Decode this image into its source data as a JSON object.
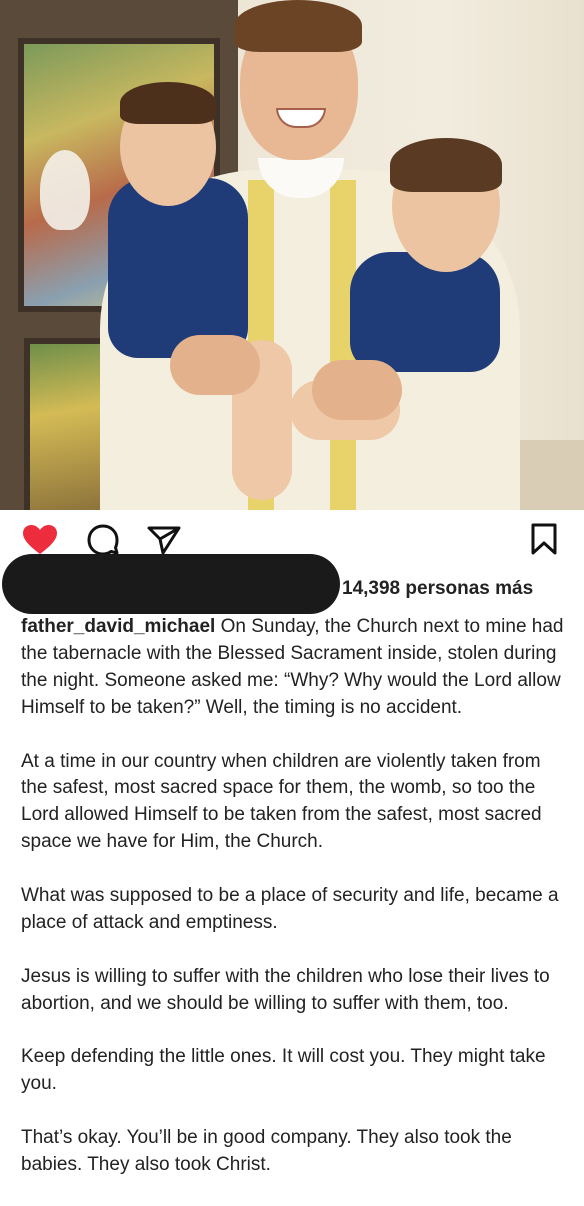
{
  "post": {
    "username": "father_david_michael",
    "likes_text": "14,398 personas más",
    "caption_first": " On Sunday, the Church next to mine had the tabernacle with the Blessed Sacrament inside, stolen during the night. Someone asked me: “Why? Why would the Lord allow Himself to be taken?” Well, the timing is no accident.",
    "paragraphs": [
      "At a time in our country when children are violently taken from the safest, most sacred space for them, the womb, so too the Lord allowed Himself to be taken from the safest, most sacred space we have for Him, the Church.",
      "What was supposed to be a place of security and life, became a place of attack and emptiness.",
      "Jesus is willing to suffer with the children who lose their lives to abortion, and we should be willing to suffer with them, too.",
      "Keep defending the little ones. It will cost you. They might take you.",
      "That’s okay. You’ll be in good company. They also took the babies. They also took Christ."
    ]
  },
  "actions": {
    "like_icon": "heart-icon",
    "comment_icon": "comment-icon",
    "share_icon": "send-icon",
    "save_icon": "bookmark-icon",
    "like_color": "#ed2c3d"
  }
}
